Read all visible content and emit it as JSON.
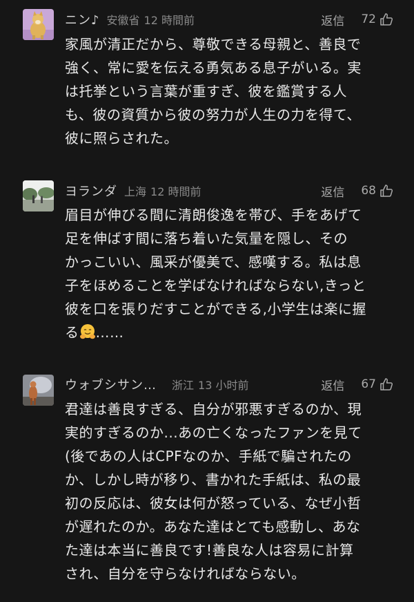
{
  "comments": [
    {
      "username": "ニン♪",
      "location": "安徽省",
      "time": "12 時間前",
      "reply_label": "返信",
      "likes": "72",
      "avatar_icon": "shiba-dog-avatar",
      "text": "家風が清正だから、尊敬できる母親と、善良で\n強く、常に愛を伝える勇気ある息子がいる。実\nは托挙という言葉が重すぎ、彼を鑑賞する人\nも、彼の資質から彼の努力が人生の力を得て、\n彼に照らされた。"
    },
    {
      "username": "ヨランダ",
      "location": "上海",
      "time": "12 時間前",
      "reply_label": "返信",
      "likes": "68",
      "avatar_icon": "park-photo-avatar",
      "text": "眉目が伸びる間に清朗俊逸を帯び、手をあげて\n足を伸ばす間に落ち着いた気量を隠し、その\nかっこいい、風采が優美で、感嘆する。私は息\n子をほめることを学ばなければならない,きっと\n彼を口を張りだすことができる,小学生は楽に握\nる",
      "text_suffix": "……",
      "emoji": "hugging-face-emoji"
    },
    {
      "username": "ウォブシサン…",
      "location": "浙江",
      "time": "13 小时前",
      "reply_label": "返信",
      "likes": "67",
      "avatar_icon": "figure-photo-avatar",
      "text": "君達は善良すぎる、自分が邪悪すぎるのか、現\n実的すぎるのか...あの亡くなったファンを見て\n(後であの人はCPFなのか、手紙で騙されたの\nか、しかし時が移り、書かれた手紙は、私の最\n初の反応は、彼女は何が怒っている、なぜ小哲\nが遅れたのか。あなた達はとても感動し、あな\nた達は本当に善良です!善良な人は容易に計算\nされ、自分を守らなければならない。"
    }
  ],
  "colors": {
    "background": "#161616",
    "text": "#e8e8e8",
    "meta": "#8a8a8a",
    "action": "#a9a9a9"
  }
}
